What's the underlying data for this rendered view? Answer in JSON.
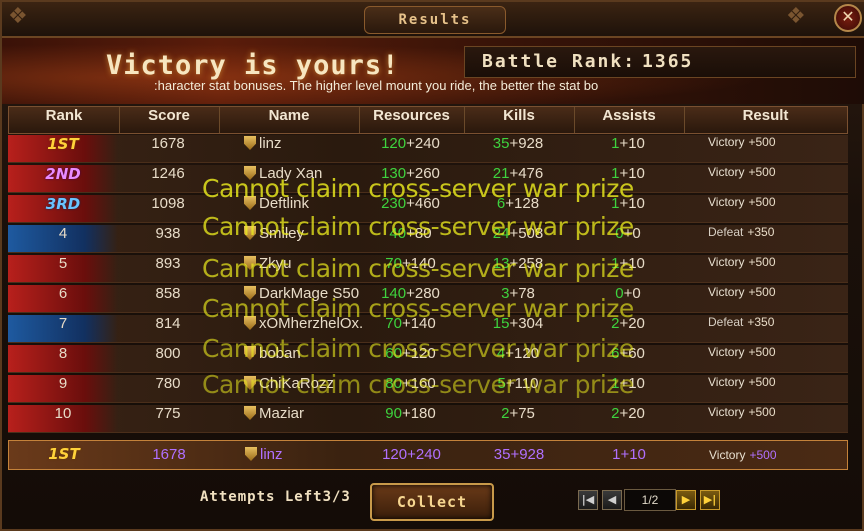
{
  "window": {
    "title": "Results",
    "close_label": "✕"
  },
  "banner": {
    "headline": "Victory is yours!",
    "battle_rank_label": "Battle Rank:",
    "battle_rank_value": "1365",
    "ticker": ":haracter stat bonuses. The higher level mount you ride, the better the stat bo"
  },
  "table": {
    "headers": [
      "Rank",
      "Score",
      "Name",
      "Resources",
      "Kills",
      "Assists",
      "Result"
    ],
    "rows": [
      {
        "rank": "1ST",
        "score": "1678",
        "name": "linz",
        "res_a": "120",
        "res_b": "+240",
        "kills_a": "35",
        "kills_b": "+928",
        "assist_a": "1",
        "assist_b": "+10",
        "result": "Victory",
        "result_val": "+500"
      },
      {
        "rank": "2ND",
        "score": "1246",
        "name": "Lady Xan",
        "res_a": "130",
        "res_b": "+260",
        "kills_a": "21",
        "kills_b": "+476",
        "assist_a": "1",
        "assist_b": "+10",
        "result": "Victory",
        "result_val": "+500"
      },
      {
        "rank": "3RD",
        "score": "1098",
        "name": "Deftlink",
        "res_a": "230",
        "res_b": "+460",
        "kills_a": "6",
        "kills_b": "+128",
        "assist_a": "1",
        "assist_b": "+10",
        "result": "Victory",
        "result_val": "+500"
      },
      {
        "rank": "4",
        "score": "938",
        "name": "Smiley",
        "res_a": "40",
        "res_b": "+80",
        "kills_a": "24",
        "kills_b": "+508",
        "assist_a": "0",
        "assist_b": "+0",
        "result": "Defeat",
        "result_val": "+350"
      },
      {
        "rank": "5",
        "score": "893",
        "name": "Zkyu",
        "res_a": "70",
        "res_b": "+140",
        "kills_a": "13",
        "kills_b": "+258",
        "assist_a": "1",
        "assist_b": "+10",
        "result": "Victory",
        "result_val": "+500"
      },
      {
        "rank": "6",
        "score": "858",
        "name": "DarkMage S50",
        "res_a": "140",
        "res_b": "+280",
        "kills_a": "3",
        "kills_b": "+78",
        "assist_a": "0",
        "assist_b": "+0",
        "result": "Victory",
        "result_val": "+500"
      },
      {
        "rank": "7",
        "score": "814",
        "name": "xOMherzhelOx.",
        "res_a": "70",
        "res_b": "+140",
        "kills_a": "15",
        "kills_b": "+304",
        "assist_a": "2",
        "assist_b": "+20",
        "result": "Defeat",
        "result_val": "+350"
      },
      {
        "rank": "8",
        "score": "800",
        "name": "boban",
        "res_a": "60",
        "res_b": "+120",
        "kills_a": "4",
        "kills_b": "+120",
        "assist_a": "6",
        "assist_b": "+60",
        "result": "Victory",
        "result_val": "+500"
      },
      {
        "rank": "9",
        "score": "780",
        "name": "ChiKaRozz",
        "res_a": "80",
        "res_b": "+160",
        "kills_a": "5",
        "kills_b": "+110",
        "assist_a": "1",
        "assist_b": "+10",
        "result": "Victory",
        "result_val": "+500"
      },
      {
        "rank": "10",
        "score": "775",
        "name": "Maziar",
        "res_a": "90",
        "res_b": "+180",
        "kills_a": "2",
        "kills_b": "+75",
        "assist_a": "2",
        "assist_b": "+20",
        "result": "Victory",
        "result_val": "+500"
      }
    ],
    "self_row": {
      "rank": "1ST",
      "score": "1678",
      "name": "linz",
      "res_a": "120",
      "res_b": "+240",
      "kills_a": "35",
      "kills_b": "+928",
      "assist_a": "1",
      "assist_b": "+10",
      "result": "Victory",
      "result_val": "+500"
    }
  },
  "overlay_message": "Cannot claim cross-server war prize",
  "footer": {
    "attempts_label": "Attempts Left",
    "attempts_value": "3/3",
    "collect_label": "Collect",
    "page_indicator": "1/2"
  },
  "icons": [
    "close-icon",
    "shield-icon",
    "first-page-icon",
    "prev-page-icon",
    "next-page-icon",
    "last-page-icon"
  ],
  "colors": {
    "green_stat": "#3ed33e",
    "self_highlight": "#b070ff",
    "overlay_text": "#ebeb1e",
    "accent_gold": "#ffd23a"
  }
}
